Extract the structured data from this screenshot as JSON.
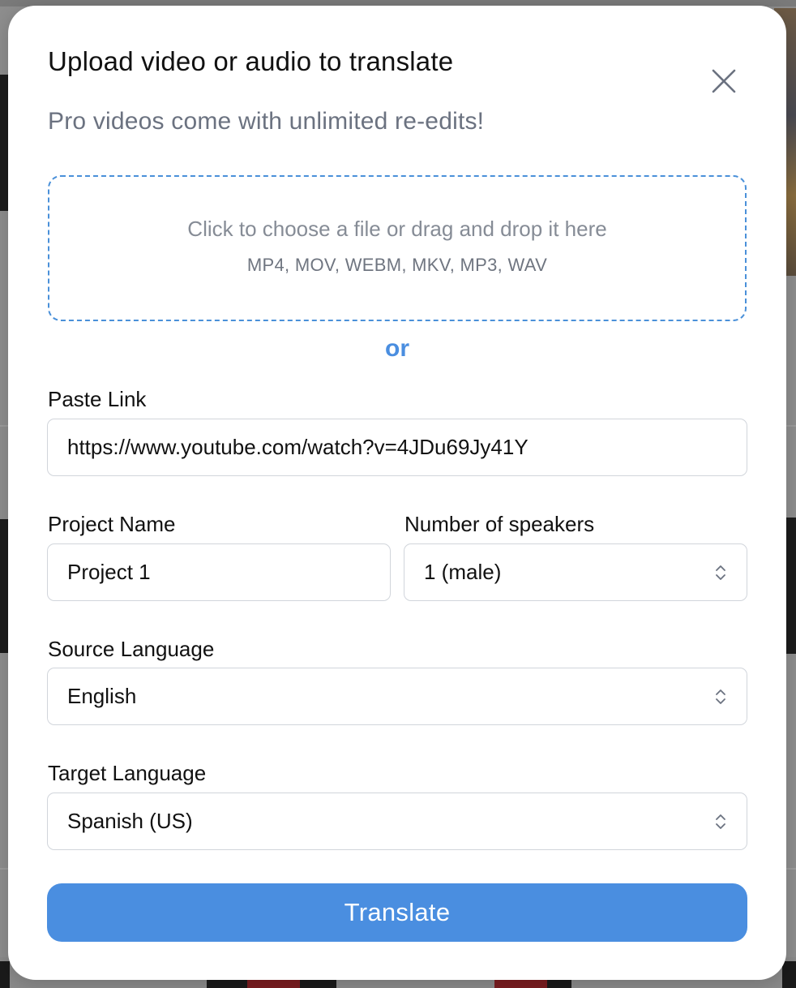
{
  "modal": {
    "title": "Upload video or audio to translate",
    "subtitle": "Pro videos come with unlimited re-edits!"
  },
  "dropzone": {
    "prompt": "Click to choose a file or drag and drop it here",
    "formats": "MP4, MOV, WEBM, MKV, MP3, WAV"
  },
  "divider": {
    "text": "or"
  },
  "link": {
    "label": "Paste Link",
    "value": "https://www.youtube.com/watch?v=4JDu69Jy41Y"
  },
  "project_name": {
    "label": "Project Name",
    "value": "Project 1"
  },
  "speakers": {
    "label": "Number of speakers",
    "selected": "1 (male)"
  },
  "source_language": {
    "label": "Source Language",
    "selected": "English"
  },
  "target_language": {
    "label": "Target Language",
    "selected": "Spanish (US)"
  },
  "actions": {
    "translate_label": "Translate"
  },
  "icons": {
    "close": "close-icon",
    "select": "chevron-up-down-icon"
  },
  "colors": {
    "accent": "#4a8ee0",
    "dropzone_border": "#4a90d9",
    "subtitle_text": "#6b7280"
  }
}
